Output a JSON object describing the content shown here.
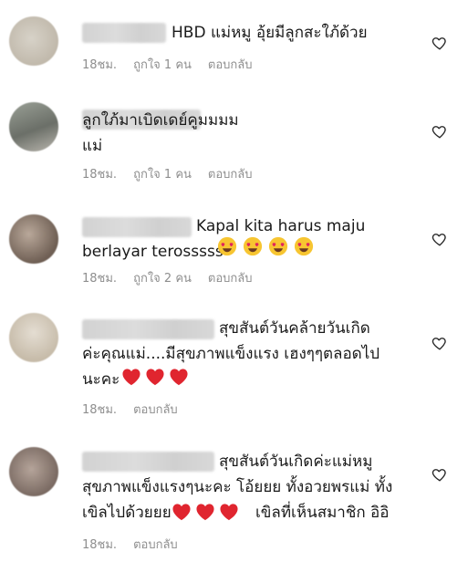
{
  "comments": [
    {
      "text": "HBD แม่หมู อุ้ยมีลูกสะใภ้ด้วย",
      "time": "18ชม.",
      "likes": "ถูกใจ 1 คน",
      "reply": "ตอบกลับ",
      "emoji": ""
    },
    {
      "text": "ลูกใภ้มาเบิดเดย์คูมมมม\nแม่",
      "time": "18ชม.",
      "likes": "ถูกใจ 1 คน",
      "reply": "ตอบกลับ",
      "emoji": ""
    },
    {
      "text": "Kapal kita harus maju\nberlayar terosssss",
      "time": "18ชม.",
      "likes": "ถูกใจ 2 คน",
      "reply": "ตอบกลับ",
      "emoji": "heart-eyes"
    },
    {
      "text": "สุขสันต์วันคล้ายวันเกิด\nค่ะคุณแม่....มีสุขภาพแข็งแรง เฮงๆๆตลอดไป\nนะคะ",
      "time": "18ชม.",
      "likes": "",
      "reply": "ตอบกลับ",
      "emoji": "red-heart"
    },
    {
      "text": "สุขสันต์วันเกิดค่ะแม่หมู\nสุขภาพแข็งแรงๆนะคะ โอ้ยยย ทั้งอวยพรแม่ ทั้ง\nเขิลไปด้วยยย",
      "text_after": "เขิลที่เห็นสมาชิก อิอิ",
      "time": "18ชม.",
      "likes": "",
      "reply": "ตอบกลับ",
      "emoji": "red-heart"
    }
  ],
  "colors": {
    "meta": "#8e8e8e",
    "heart_outline": "#262626"
  }
}
